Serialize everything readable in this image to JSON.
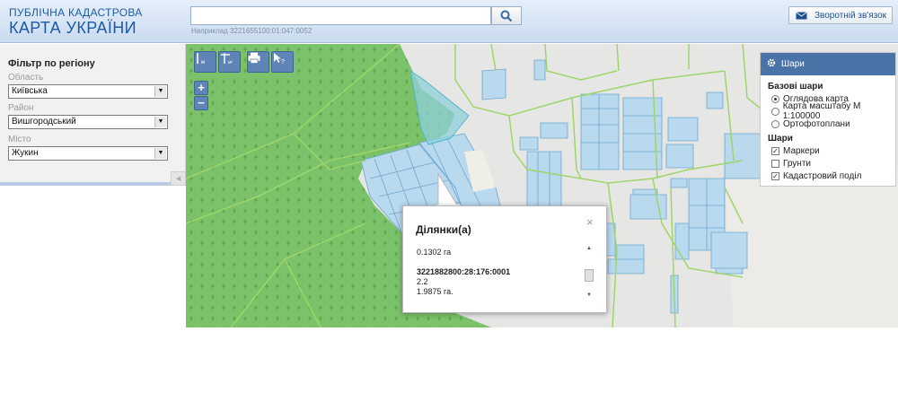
{
  "header": {
    "logo_line1": "ПУБЛІЧНА КАДАСТРОВА",
    "logo_line2": "КАРТА УКРАЇНИ",
    "search_value": "",
    "search_hint": "Наприклад 3221655100:01:047:0052",
    "feedback_label": "Зворотній зв'язок"
  },
  "filter": {
    "title": "Фільтр по регіону",
    "oblast_label": "Область",
    "oblast_value": "Київська",
    "rayon_label": "Район",
    "rayon_value": "Вишгородський",
    "city_label": "Місто",
    "city_value": "Жукин"
  },
  "map_tools": {
    "zoom_in": "+",
    "zoom_out": "−",
    "tool_icons": [
      "measure-line-icon",
      "measure-area-icon",
      "print-icon",
      "identify-icon"
    ]
  },
  "layers": {
    "title": "Шари",
    "base_title": "Базові шари",
    "base_layers": [
      {
        "label": "Оглядова карта",
        "selected": true
      },
      {
        "label": "Карта масштабу М 1:100000",
        "selected": false
      },
      {
        "label": "Ортофотоплани",
        "selected": false
      }
    ],
    "overlay_title": "Шари",
    "overlays": [
      {
        "label": "Маркери",
        "checked": true
      },
      {
        "label": "Грунти",
        "checked": false
      },
      {
        "label": "Кадастровий поділ",
        "checked": true
      }
    ]
  },
  "popup": {
    "title": "Ділянки(а)",
    "close": "×",
    "first_area": "0.1302 га",
    "cadastral_number": "3221882800:28:176:0001",
    "purpose": "2.2",
    "area": "1.9875 га."
  },
  "colors": {
    "forest": "#7cc26a",
    "parcel_fill": "#b9d9ef",
    "parcel_stroke": "#6ea6cc",
    "boundary": "#9ed56b",
    "selected_parcel": "#8fd0dc",
    "accent": "#4a73a8"
  }
}
